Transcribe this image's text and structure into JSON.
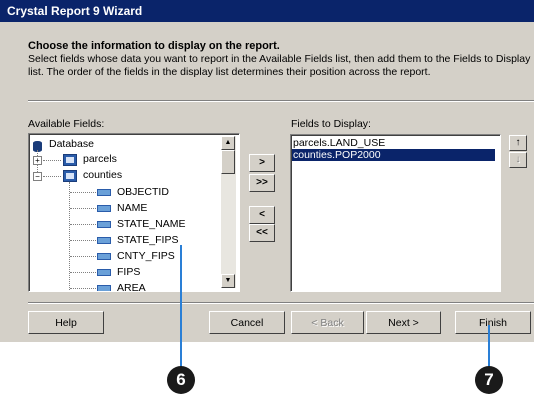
{
  "window": {
    "title": "Crystal Report 9 Wizard"
  },
  "header": {
    "heading": "Choose the information to display on the report.",
    "description": "Select fields whose data you want to report in the Available Fields list, then add them to the Fields to Display\nlist. The order of the fields in the display list determines their position across the report."
  },
  "available": {
    "label": "Available Fields:",
    "root": "Database",
    "tables": [
      {
        "name": "parcels",
        "expanded": false
      },
      {
        "name": "counties",
        "expanded": true
      }
    ],
    "fields": [
      "OBJECTID",
      "NAME",
      "STATE_NAME",
      "STATE_FIPS",
      "CNTY_FIPS",
      "FIPS",
      "AREA"
    ]
  },
  "move_buttons": {
    "add": ">",
    "add_all": ">>",
    "remove": "<",
    "remove_all": "<<"
  },
  "display": {
    "label": "Fields to Display:",
    "items": [
      "parcels.LAND_USE",
      "counties.POP2000"
    ],
    "selected_index": 1
  },
  "order_buttons": {
    "up": "↑",
    "down": "↓"
  },
  "footer": {
    "help": "Help",
    "cancel": "Cancel",
    "back": "< Back",
    "next": "Next >",
    "finish": "Finish"
  },
  "callouts": [
    "6",
    "7"
  ],
  "colors": {
    "titlebar": "#0a246a",
    "dialog": "#d4d0c8",
    "selection": "#0a246a",
    "callout_line": "#2a7fd6"
  }
}
